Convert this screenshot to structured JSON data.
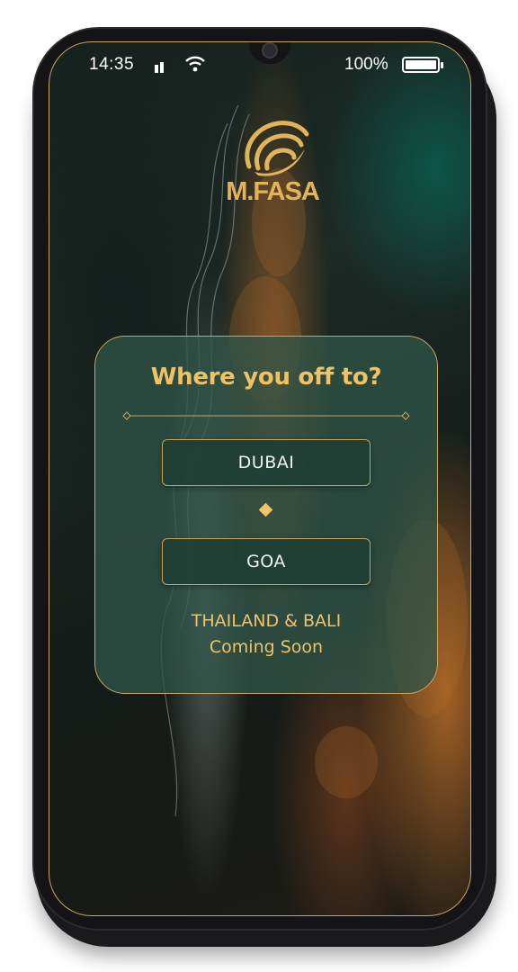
{
  "status_bar": {
    "time": "14:35",
    "battery": "100%"
  },
  "logo": {
    "brand_name": "M.FASA"
  },
  "card": {
    "title": "Where you off to?",
    "destinations": [
      {
        "label": "DUBAI"
      },
      {
        "label": "GOA"
      }
    ],
    "coming_soon_line1": "THAILAND & BALI",
    "coming_soon_line2": "Coming Soon"
  },
  "colors": {
    "accent_gold": "#c9a45a",
    "title_gold": "#f0c266",
    "card_green": "#305448"
  },
  "icons": [
    "signal-icon",
    "wifi-icon",
    "battery-icon",
    "brand-logo-icon",
    "diamond-icon"
  ]
}
